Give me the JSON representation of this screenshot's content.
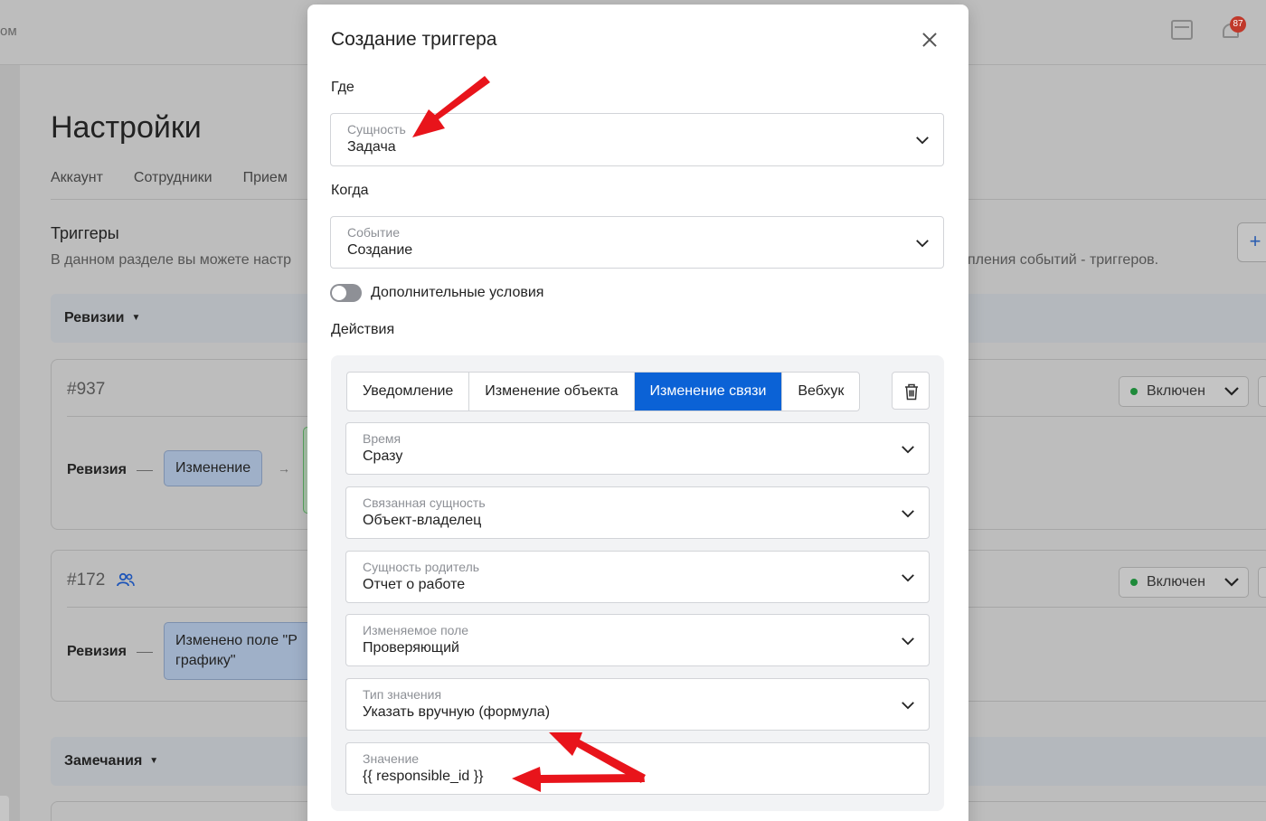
{
  "background": {
    "brand_fragment": "ом",
    "notifications_badge": "87",
    "page_title": "Настройки",
    "tabs": [
      "Аккаунт",
      "Сотрудники",
      "Прием"
    ],
    "section_title": "Триггеры",
    "section_desc": "В данном разделе вы можете настр",
    "section_desc_tail": "пления событий - триггеров.",
    "add_button": "+",
    "groups": [
      {
        "label": "Ревизии"
      },
      {
        "label": "Замечания"
      }
    ],
    "cards": [
      {
        "id": "#937",
        "row_label": "Ревизия",
        "chip": "Изменение",
        "status": "Включен"
      },
      {
        "id": "#172",
        "row_label": "Ревизия",
        "chip_line1": "Изменено поле \"Р",
        "chip_line2": "графику\"",
        "status": "Включен"
      }
    ]
  },
  "modal": {
    "title": "Создание триггера",
    "where_label": "Где",
    "entity": {
      "label": "Сущность",
      "value": "Задача"
    },
    "when_label": "Когда",
    "event": {
      "label": "Событие",
      "value": "Создание"
    },
    "extra_conditions_label": "Дополнительные условия",
    "extra_conditions_on": false,
    "actions_label": "Действия",
    "action_tabs": [
      "Уведомление",
      "Изменение объекта",
      "Изменение связи",
      "Вебхук"
    ],
    "active_action_tab": "Изменение связи",
    "fields": [
      {
        "label": "Время",
        "value": "Сразу"
      },
      {
        "label": "Связанная сущность",
        "value": "Объект-владелец"
      },
      {
        "label": "Сущность родитель",
        "value": "Отчет о работе"
      },
      {
        "label": "Изменяемое поле",
        "value": "Проверяющий"
      },
      {
        "label": "Тип значения",
        "value": "Указать вручную (формула)"
      }
    ],
    "value_field": {
      "label": "Значение",
      "value": "{{ responsible_id }}"
    }
  },
  "colors": {
    "accent": "#0b62d6",
    "annotation_arrow": "#e8141b",
    "status_dot": "#1e8a3a"
  },
  "icons": [
    "close-icon",
    "chevron-down-icon",
    "trash-icon",
    "calendar-icon",
    "bell-icon",
    "users-icon"
  ]
}
